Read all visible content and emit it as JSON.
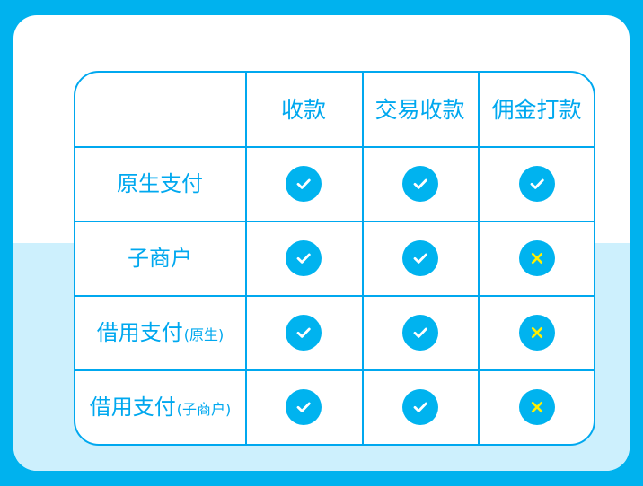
{
  "table": {
    "columns": [
      "收款",
      "交易收款",
      "佣金打款"
    ],
    "rows": [
      {
        "label": "原生支付",
        "note": "",
        "values": [
          "check",
          "check",
          "check"
        ]
      },
      {
        "label": "子商户",
        "note": "",
        "values": [
          "check",
          "check",
          "cross"
        ]
      },
      {
        "label": "借用支付",
        "note": "(原生)",
        "values": [
          "check",
          "check",
          "cross"
        ]
      },
      {
        "label": "借用支付",
        "note": "(子商户)",
        "values": [
          "check",
          "check",
          "cross"
        ]
      }
    ]
  },
  "icons": {
    "check": "check-circle-icon",
    "cross": "cross-circle-icon"
  },
  "colors": {
    "outer_background": "#00b2ee",
    "card_background": "#ffffff",
    "card_band": "#cdf0fd",
    "table_border": "#00a8ef",
    "text": "#00a8ef",
    "status_circle": "#00b3ef",
    "check_mark": "#ffffff",
    "cross_mark": "#ffef00"
  }
}
